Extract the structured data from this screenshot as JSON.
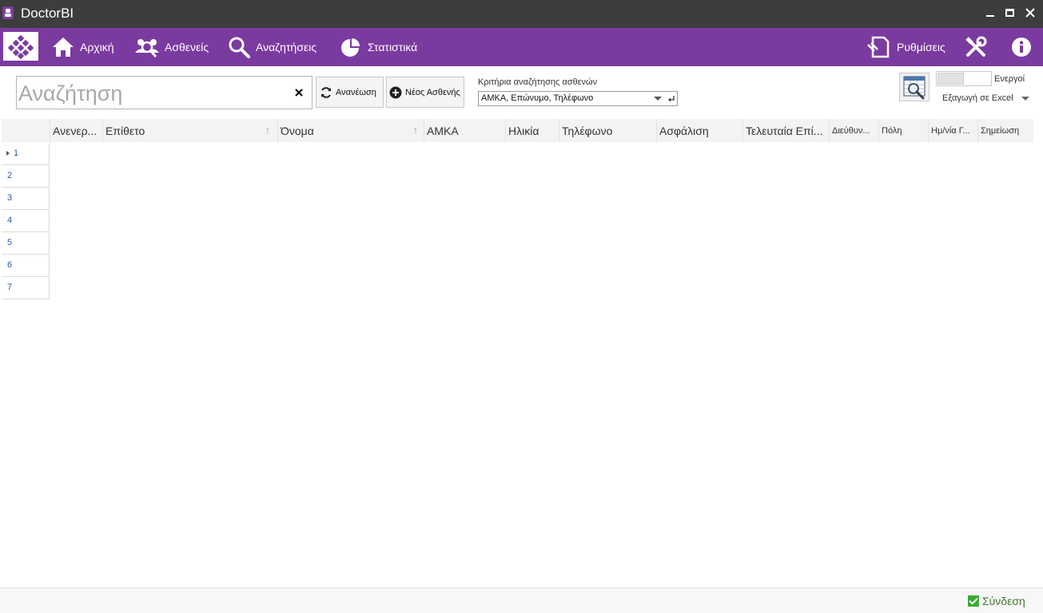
{
  "window": {
    "title": "DoctorBI"
  },
  "nav": {
    "home": "Αρχική",
    "patients": "Ασθενείς",
    "searches": "Αναζητήσεις",
    "statistics": "Στατιστικά",
    "settings": "Ρυθμίσεις"
  },
  "toolbar": {
    "search_placeholder": "Αναζήτηση",
    "search_value": "",
    "refresh_label": "Ανανέωση",
    "new_patient_label": "Νέος Ασθενής",
    "criteria_label": "Κριτήρια αναζήτησης ασθενών",
    "criteria_value": "ΑΜΚΑ, Επώνυμο, Τηλέφωνο",
    "toggle_label": "Ενεργοί",
    "export_label": "Εξαγωγή σε Excel"
  },
  "grid": {
    "columns": [
      "Ανενερ...",
      "Επίθετο",
      "Όνομα",
      "ΑΜΚΑ",
      "Ηλικία",
      "Τηλέφωνο",
      "Ασφάλιση",
      "Τελευταία Επί...",
      "Διεύθυν...",
      "Πόλη",
      "Ημ/νία Γ...",
      "Σημείωση"
    ],
    "rows": [
      "1",
      "2",
      "3",
      "4",
      "5",
      "6",
      "7"
    ]
  },
  "status": {
    "login": "Σύνδεση"
  },
  "colors": {
    "titlebar": "#3d3d3d",
    "accent": "#7b3aa0",
    "status_ok": "#3aaa35"
  }
}
